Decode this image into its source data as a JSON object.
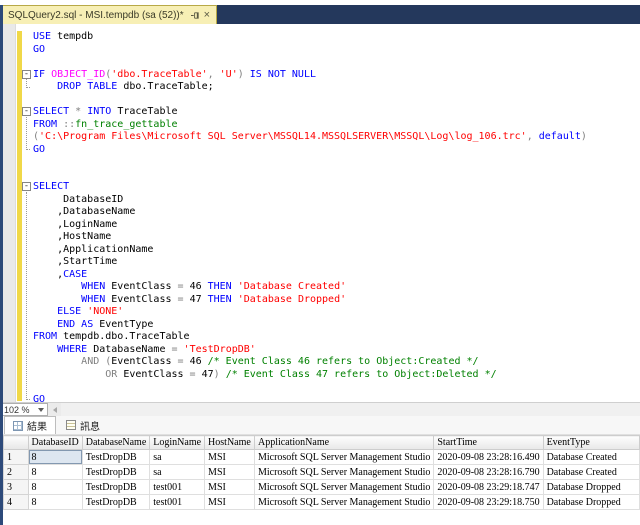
{
  "window": {
    "tab_title": "SQLQuery2.sql - MSI.tempdb (sa (52))*"
  },
  "editor": {
    "zoom_level": "102 %",
    "lines": [
      {
        "t": [
          [
            "kw",
            "USE"
          ],
          [
            "id",
            " tempdb"
          ]
        ]
      },
      {
        "t": [
          [
            "kw",
            "GO"
          ]
        ]
      },
      {
        "t": []
      },
      {
        "fold": true,
        "t": [
          [
            "kw",
            "IF "
          ],
          [
            "fn",
            "OBJECT_ID"
          ],
          [
            "op",
            "("
          ],
          [
            "str",
            "'dbo.TraceTable'"
          ],
          [
            "op",
            ", "
          ],
          [
            "str",
            "'U'"
          ],
          [
            "op",
            ") "
          ],
          [
            "kw",
            "IS NOT NULL"
          ]
        ]
      },
      {
        "t": [
          [
            "id",
            "    "
          ],
          [
            "kw",
            "DROP TABLE"
          ],
          [
            "id",
            " dbo.TraceTable;"
          ]
        ]
      },
      {
        "t": []
      },
      {
        "fold": true,
        "t": [
          [
            "kw",
            "SELECT "
          ],
          [
            "op",
            "* "
          ],
          [
            "kw",
            "INTO"
          ],
          [
            "id",
            " TraceTable"
          ]
        ]
      },
      {
        "t": [
          [
            "kw",
            "FROM "
          ],
          [
            "op",
            "::"
          ],
          [
            "sysfn",
            "fn_trace_gettable"
          ]
        ]
      },
      {
        "t": [
          [
            "op",
            "("
          ],
          [
            "str",
            "'C:\\Program Files\\Microsoft SQL Server\\MSSQL14.MSSQLSERVER\\MSSQL\\Log\\log_106.trc'"
          ],
          [
            "op",
            ", "
          ],
          [
            "kw",
            "default"
          ],
          [
            "op",
            ")"
          ]
        ]
      },
      {
        "t": [
          [
            "kw",
            "GO"
          ]
        ]
      },
      {
        "t": []
      },
      {
        "t": []
      },
      {
        "fold": true,
        "t": [
          [
            "kw",
            "SELECT"
          ]
        ]
      },
      {
        "t": [
          [
            "id",
            "     DatabaseID"
          ]
        ]
      },
      {
        "t": [
          [
            "id",
            "    ,DatabaseName"
          ]
        ]
      },
      {
        "t": [
          [
            "id",
            "    ,LoginName"
          ]
        ]
      },
      {
        "t": [
          [
            "id",
            "    ,HostName"
          ]
        ]
      },
      {
        "t": [
          [
            "id",
            "    ,ApplicationName"
          ]
        ]
      },
      {
        "t": [
          [
            "id",
            "    ,StartTime"
          ]
        ]
      },
      {
        "t": [
          [
            "id",
            "    ,"
          ],
          [
            "kw",
            "CASE"
          ]
        ]
      },
      {
        "t": [
          [
            "id",
            "        "
          ],
          [
            "kw",
            "WHEN"
          ],
          [
            "id",
            " EventClass "
          ],
          [
            "op",
            "= "
          ],
          [
            "id",
            "46 "
          ],
          [
            "kw",
            "THEN"
          ],
          [
            "str",
            " 'Database Created'"
          ]
        ]
      },
      {
        "t": [
          [
            "id",
            "        "
          ],
          [
            "kw",
            "WHEN"
          ],
          [
            "id",
            " EventClass "
          ],
          [
            "op",
            "= "
          ],
          [
            "id",
            "47 "
          ],
          [
            "kw",
            "THEN"
          ],
          [
            "str",
            " 'Database Dropped'"
          ]
        ]
      },
      {
        "t": [
          [
            "id",
            "    "
          ],
          [
            "kw",
            "ELSE"
          ],
          [
            "str",
            " 'NONE'"
          ]
        ]
      },
      {
        "t": [
          [
            "id",
            "    "
          ],
          [
            "kw",
            "END AS"
          ],
          [
            "id",
            " EventType"
          ]
        ]
      },
      {
        "t": [
          [
            "kw",
            "FROM"
          ],
          [
            "id",
            " tempdb.dbo.TraceTable"
          ]
        ]
      },
      {
        "t": [
          [
            "id",
            "    "
          ],
          [
            "kw",
            "WHERE"
          ],
          [
            "id",
            " DatabaseName "
          ],
          [
            "op",
            "= "
          ],
          [
            "str",
            "'TestDropDB'"
          ]
        ]
      },
      {
        "t": [
          [
            "id",
            "        "
          ],
          [
            "op",
            "AND ("
          ],
          [
            "id",
            "EventClass "
          ],
          [
            "op",
            "= "
          ],
          [
            "id",
            "46 "
          ],
          [
            "cm",
            "/* Event Class 46 refers to Object:Created */"
          ]
        ]
      },
      {
        "t": [
          [
            "id",
            "            "
          ],
          [
            "op",
            "OR "
          ],
          [
            "id",
            "EventClass "
          ],
          [
            "op",
            "= "
          ],
          [
            "id",
            "47"
          ],
          [
            "op",
            ") "
          ],
          [
            "cm",
            "/* Event Class 47 refers to Object:Deleted */"
          ]
        ]
      },
      {
        "t": []
      },
      {
        "t": [
          [
            "kw",
            "GO"
          ]
        ]
      }
    ]
  },
  "results_pane": {
    "tabs": [
      {
        "label": "結果",
        "icon": "results-grid-icon",
        "active": true
      },
      {
        "label": "訊息",
        "icon": "messages-icon",
        "active": false
      }
    ]
  },
  "grid": {
    "columns": [
      "",
      "DatabaseID",
      "DatabaseName",
      "LoginName",
      "HostName",
      "ApplicationName",
      "StartTime",
      "EventType"
    ],
    "rows": [
      [
        "1",
        "8",
        "TestDropDB",
        "sa",
        "MSI",
        "Microsoft SQL Server Management Studio",
        "2020-09-08 23:28:16.490",
        "Database Created"
      ],
      [
        "2",
        "8",
        "TestDropDB",
        "sa",
        "MSI",
        "Microsoft SQL Server Management Studio",
        "2020-09-08 23:28:16.790",
        "Database Created"
      ],
      [
        "3",
        "8",
        "TestDropDB",
        "test001",
        "MSI",
        "Microsoft SQL Server Management Studio",
        "2020-09-08 23:29:18.747",
        "Database Dropped"
      ],
      [
        "4",
        "8",
        "TestDropDB",
        "test001",
        "MSI",
        "Microsoft SQL Server Management Studio",
        "2020-09-08 23:29:18.750",
        "Database Dropped"
      ]
    ],
    "focused_cell": {
      "row": 0,
      "col": 1
    }
  },
  "colors": {
    "titlebar_navy": "#24385c",
    "tab_yellow": "#f7efb5",
    "change_bar_yellow": "#f0d848",
    "keyword_blue": "#0000ff",
    "string_red": "#ff0000",
    "comment_green": "#008000",
    "system_function_magenta": "#ff00ff",
    "operator_gray": "#808080",
    "focused_cell_blue": "#dde6f0"
  }
}
